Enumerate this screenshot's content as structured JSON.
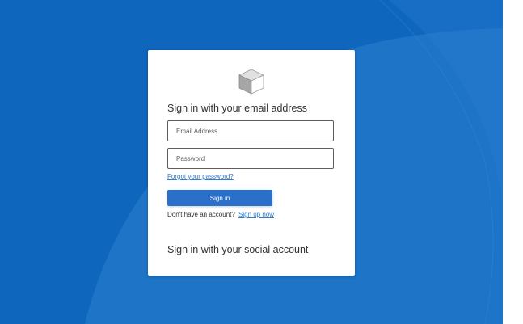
{
  "colors": {
    "background": "#0f66bd",
    "background_highlight": "#2c7fd0",
    "card": "#ffffff",
    "primary_button": "#2a6fca",
    "link": "#2b7cd3",
    "text": "#323130"
  },
  "logo": {
    "icon": "cube-icon"
  },
  "signin_form": {
    "heading": "Sign in with your email address",
    "email_placeholder": "Email Address",
    "email_value": "",
    "password_placeholder": "Password",
    "password_value": "",
    "forgot_password_link": "Forgot your password?",
    "signin_button": "Sign in",
    "no_account_text": "Don't have an account?",
    "signup_link": "Sign up now"
  },
  "social": {
    "heading": "Sign in with your social account"
  }
}
